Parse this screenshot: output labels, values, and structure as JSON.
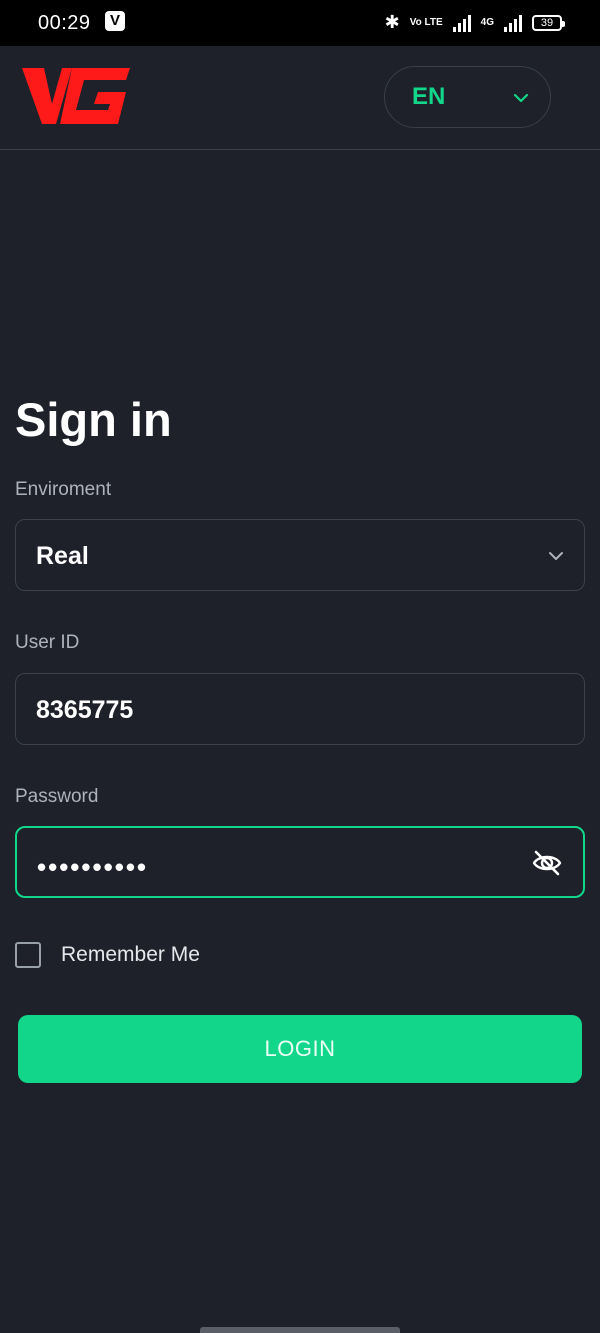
{
  "status_bar": {
    "time": "00:29",
    "app_badge": "V",
    "volte": "Vo LTE",
    "network": "4G",
    "battery": "39"
  },
  "header": {
    "logo_text": "VG",
    "language": "EN"
  },
  "form": {
    "title": "Sign in",
    "environment_label": "Enviroment",
    "environment_value": "Real",
    "user_id_label": "User ID",
    "user_id_value": "8365775",
    "password_label": "Password",
    "password_mask": "••••••••••",
    "remember_label": "Remember Me",
    "login_label": "LOGIN"
  },
  "colors": {
    "background": "#1e2129",
    "accent": "#12d68a",
    "logo_red": "#ff1a1a"
  }
}
